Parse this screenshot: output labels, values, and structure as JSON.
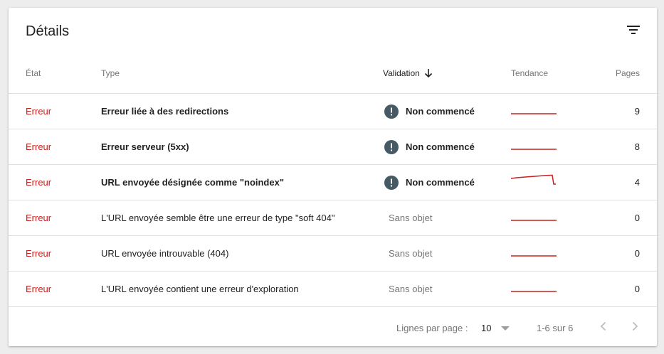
{
  "panel": {
    "title": "Détails"
  },
  "icons": {
    "filter": "filter-icon",
    "status": "exclamation-circle-icon",
    "sort": "arrow-down-icon",
    "prev": "chevron-left-icon",
    "next": "chevron-right-icon",
    "dropdown": "triangle-down-icon"
  },
  "colors": {
    "error_text": "#c5221f",
    "trend_line": "#c5221f",
    "status_icon": "#455a64"
  },
  "table": {
    "headers": {
      "etat": "État",
      "type": "Type",
      "validation": "Validation",
      "tendance": "Tendance",
      "pages": "Pages"
    },
    "rows": [
      {
        "etat": "Erreur",
        "type": "Erreur liée à des redirections",
        "validation": "Non commencé",
        "pages": "9"
      },
      {
        "etat": "Erreur",
        "type": "Erreur serveur (5xx)",
        "validation": "Non commencé",
        "pages": "8"
      },
      {
        "etat": "Erreur",
        "type": "URL envoyée désignée comme \"noindex\"",
        "validation": "Non commencé",
        "pages": "4"
      },
      {
        "etat": "Erreur",
        "type": "L'URL envoyée semble être une erreur de type \"soft 404\"",
        "validation": "Sans objet",
        "pages": "0"
      },
      {
        "etat": "Erreur",
        "type": "URL envoyée introuvable (404)",
        "validation": "Sans objet",
        "pages": "0"
      },
      {
        "etat": "Erreur",
        "type": "L'URL envoyée contient une erreur d'exploration",
        "validation": "Sans objet",
        "pages": "0"
      }
    ]
  },
  "pagination": {
    "rows_label": "Lignes par page :",
    "rows_value": "10",
    "range": "1-6 sur 6"
  }
}
